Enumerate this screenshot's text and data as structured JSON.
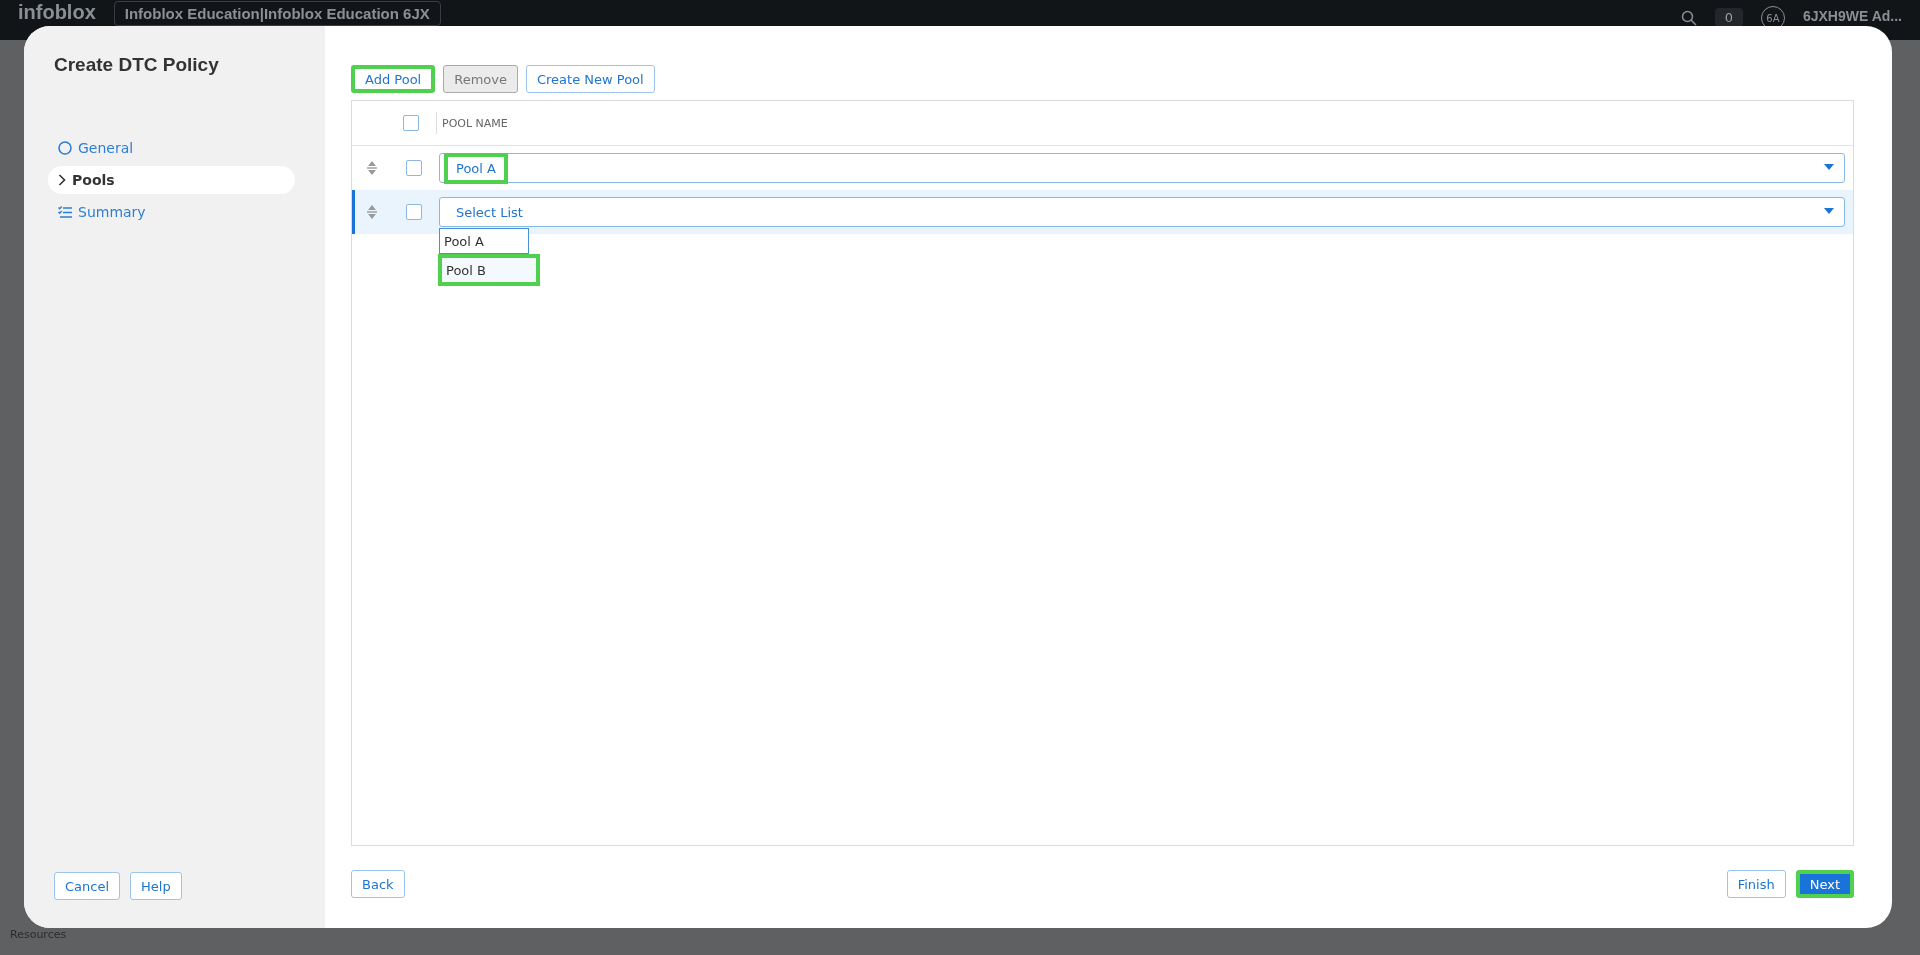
{
  "top_bar": {
    "logo": "infoblox",
    "account_selector": "Infoblox Education|Infoblox Education 6JX",
    "notification_count": "0",
    "user_initials": "6A",
    "user_name": "6JXH9WE Ad..."
  },
  "left_nav": {
    "items": [
      {
        "label": "Resources"
      }
    ]
  },
  "dialog": {
    "title": "Create DTC Policy",
    "steps": [
      {
        "label": "General",
        "kind": "circle",
        "selected": false
      },
      {
        "label": "Pools",
        "kind": "chevron",
        "selected": true
      },
      {
        "label": "Summary",
        "kind": "list",
        "selected": false
      }
    ],
    "toolbar": [
      {
        "label": "Add Pool",
        "disabled": false,
        "highlighted": true
      },
      {
        "label": "Remove",
        "disabled": true,
        "highlighted": false
      },
      {
        "label": "Create New Pool",
        "disabled": false,
        "highlighted": false
      }
    ],
    "table": {
      "columns": [
        "POOL NAME"
      ],
      "header_checked": false,
      "rows": [
        {
          "checked": false,
          "selected": false,
          "value": "Pool A",
          "highlighted": true
        },
        {
          "checked": false,
          "selected": true,
          "placeholder": "Select List",
          "highlighted": false,
          "options": [
            {
              "label": "Pool A",
              "focused": true,
              "highlighted": false
            },
            {
              "label": "Pool B",
              "focused": false,
              "highlighted": true
            }
          ]
        }
      ]
    },
    "footer_left": [
      {
        "label": "Cancel"
      },
      {
        "label": "Help"
      }
    ],
    "back": {
      "label": "Back"
    },
    "footer_right": [
      {
        "label": "Finish",
        "primary": false,
        "highlighted": false
      },
      {
        "label": "Next",
        "primary": true,
        "highlighted": true
      }
    ]
  }
}
